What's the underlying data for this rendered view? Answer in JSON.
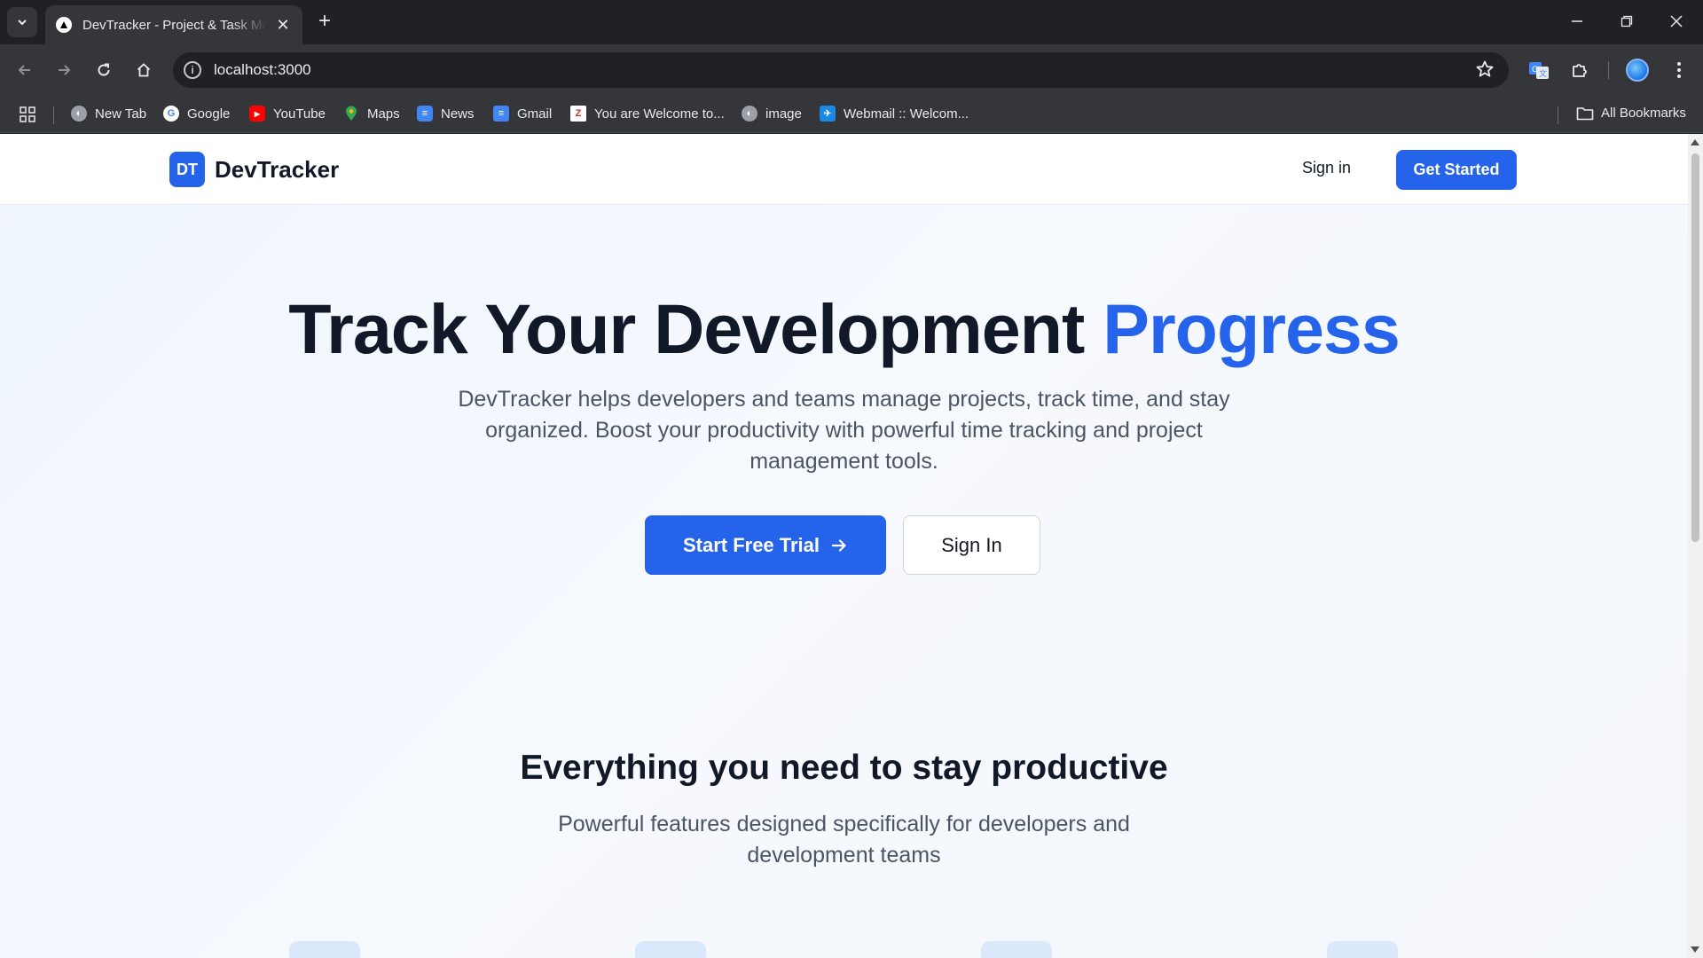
{
  "browser": {
    "tab": {
      "title": "DevTracker - Project & Task Management"
    },
    "address": {
      "url": "localhost:3000"
    },
    "bookmarks": [
      {
        "label": "New Tab",
        "icon": "globe-icon",
        "color": "#9aa0a6"
      },
      {
        "label": "Google",
        "icon": "google-icon",
        "color": "#ffffff"
      },
      {
        "label": "YouTube",
        "icon": "youtube-icon",
        "color": "#ff0000"
      },
      {
        "label": "Maps",
        "icon": "maps-icon",
        "color": "#34a853"
      },
      {
        "label": "News",
        "icon": "news-icon",
        "color": "#4285f4"
      },
      {
        "label": "Gmail",
        "icon": "docs-icon",
        "color": "#4285f4"
      },
      {
        "label": "You are Welcome to...",
        "icon": "site-icon",
        "color": "#c62828"
      },
      {
        "label": "image",
        "icon": "globe-icon",
        "color": "#9aa0a6"
      },
      {
        "label": "Webmail :: Welcom...",
        "icon": "webmail-icon",
        "color": "#1e88e5"
      }
    ],
    "all_bookmarks": "All Bookmarks"
  },
  "site": {
    "logo_badge": "DT",
    "logo_text": "DevTracker",
    "nav": {
      "signin": "Sign in",
      "get_started": "Get Started"
    },
    "hero": {
      "title_main": "Track Your Development ",
      "title_accent": "Progress",
      "subtitle": "DevTracker helps developers and teams manage projects, track time, and stay organized. Boost your productivity with powerful time tracking and project management tools.",
      "primary_cta": "Start Free Trial",
      "secondary_cta": "Sign In"
    },
    "features": {
      "title": "Everything you need to stay productive",
      "subtitle": "Powerful features designed specifically for developers and development teams"
    }
  },
  "colors": {
    "brand": "#2563eb",
    "heading": "#111827",
    "body_text": "#4b5563"
  }
}
